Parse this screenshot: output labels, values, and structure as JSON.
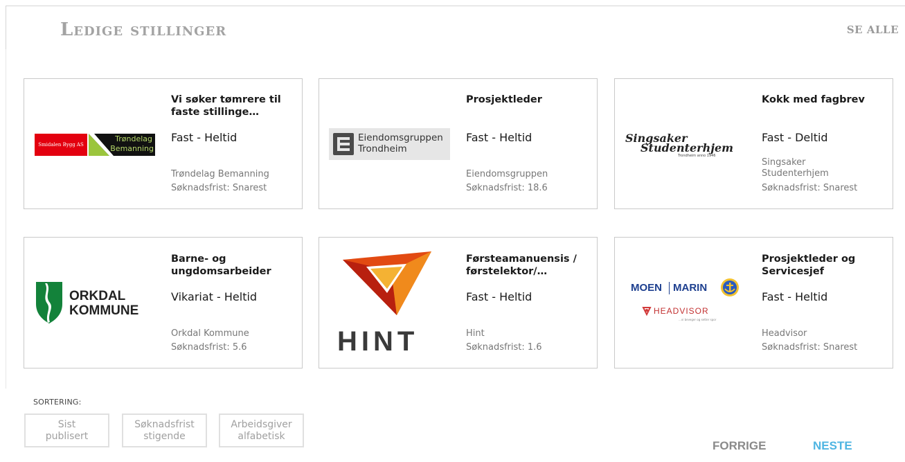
{
  "header": {
    "title": "Ledige stillinger",
    "see_all": "SE ALLE"
  },
  "jobs": [
    {
      "title": "Vi søker tømrere til faste stillinge…",
      "type": "Fast - Heltid",
      "employer": "Trøndelag Bemanning",
      "deadline": "Søknadsfrist: Snarest",
      "logo_text": [
        "Smidalen Bygg AS",
        "Trøndelag",
        "Bemanning"
      ]
    },
    {
      "title": "Prosjektleder",
      "type": "Fast - Heltid",
      "employer": "Eiendomsgruppen",
      "deadline": "Søknadsfrist: 18.6",
      "logo_text": [
        "Eiendomsgruppen",
        "Trondheim"
      ]
    },
    {
      "title": "Kokk med fagbrev",
      "type": "Fast - Deltid",
      "employer": "Singsaker Studenterhjem",
      "deadline": "Søknadsfrist: Snarest",
      "logo_text": [
        "Singsaker",
        "Studenterhjem",
        "Trondheim anno 1946"
      ]
    },
    {
      "title": "Barne- og ungdomsarbeider",
      "type": "Vikariat - Heltid",
      "employer": "Orkdal Kommune",
      "deadline": "Søknadsfrist: 5.6",
      "logo_text": [
        "ORKDAL",
        "KOMMUNE"
      ]
    },
    {
      "title": "Førsteamanuensis / førstelektor/…",
      "type": "Fast - Heltid",
      "employer": "Hint",
      "deadline": "Søknadsfrist: 1.6",
      "logo_text": [
        "HINT"
      ]
    },
    {
      "title": "Prosjektleder og Servicesjef",
      "type": "Fast - Heltid",
      "employer": "Headvisor",
      "deadline": "Søknadsfrist: Snarest",
      "logo_text": [
        "MOEN",
        "MARIN",
        "HEADVISOR",
        "...vi beveger og setter spor"
      ]
    }
  ],
  "sorting": {
    "label": "SORTERING:",
    "options": [
      [
        "Sist",
        "publisert"
      ],
      [
        "Søknadsfrist",
        "stigende"
      ],
      [
        "Arbeidsgiver",
        "alfabetisk"
      ]
    ]
  },
  "pager": {
    "prev": "FORRIGE",
    "next": "NESTE"
  },
  "colors": {
    "title_gray": "#a3a3a3",
    "next_blue": "#4fb5e2",
    "prev_gray": "#8a8a8a",
    "hint_red": "#d52b1e",
    "orkdal_green": "#13823a"
  }
}
